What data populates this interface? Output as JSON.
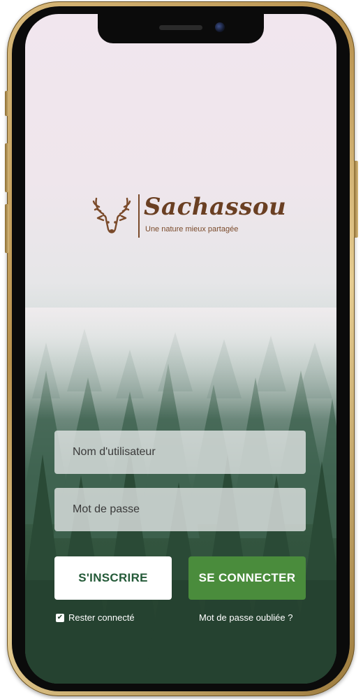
{
  "app": {
    "brand_name": "Sachassou",
    "tagline": "Une nature mieux partagée",
    "logo_icon": "deer-head-icon"
  },
  "login": {
    "username_placeholder": "Nom d'utilisateur",
    "password_placeholder": "Mot de passe",
    "register_label": "S'INSCRIRE",
    "login_label": "SE CONNECTER",
    "remember_label": "Rester connecté",
    "remember_checked": true,
    "forgot_label": "Mot de passe oubliée ?"
  },
  "colors": {
    "brand_brown": "#6a3f22",
    "login_button": "#4a8c3c",
    "register_text": "#245a38"
  }
}
